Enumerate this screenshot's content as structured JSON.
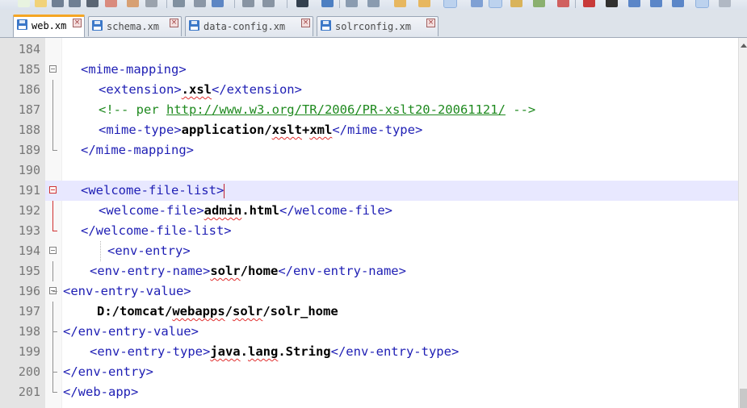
{
  "toolbar": {
    "buttons": [
      "new-file-icon",
      "open-file-icon",
      "save-icon",
      "save-all-icon",
      "close-icon",
      "close-all-icon",
      "print-icon",
      "cut-icon",
      "copy-icon",
      "paste-icon",
      "undo-icon",
      "redo-icon",
      "find-icon",
      "replace-icon",
      "zoom-in-icon",
      "zoom-out-icon",
      "sync-scroll-icon",
      "word-wrap-icon",
      "show-all-chars-icon",
      "indent-guide-icon",
      "user-lang-icon",
      "doc-map-icon",
      "record-macro-icon",
      "stop-record-icon",
      "play-macro-icon",
      "run-macro-icon",
      "save-macro-icon",
      "spellcheck-icon"
    ]
  },
  "tabs": [
    {
      "label": "web.xm",
      "active": true
    },
    {
      "label": "schema.xm",
      "active": false
    },
    {
      "label": "data-config.xm",
      "active": false
    },
    {
      "label": "solrconfig.xm",
      "active": false
    }
  ],
  "editor": {
    "current_line": 191,
    "lines": [
      {
        "num": "184"
      },
      {
        "num": "185",
        "t1": "<mime-mapping>"
      },
      {
        "num": "186",
        "t1": "<extension>",
        "v": ".xsl",
        "t2": "</extension>"
      },
      {
        "num": "187",
        "c1": "<!-- per ",
        "url": "http://www.w3.org/TR/2006/PR-xslt20-20061121/",
        "c2": " -->"
      },
      {
        "num": "188",
        "t1": "<mime-type>",
        "v": "application/xslt+xml",
        "t2": "</mime-type>"
      },
      {
        "num": "189",
        "t1": "</mime-mapping>"
      },
      {
        "num": "190"
      },
      {
        "num": "191",
        "t1": "<welcome-file-list>"
      },
      {
        "num": "192",
        "t1": "<welcome-file>",
        "v": "admin.html",
        "t2": "</welcome-file>"
      },
      {
        "num": "193",
        "t1": "</welcome-file-list>"
      },
      {
        "num": "194",
        "t1": "<env-entry>"
      },
      {
        "num": "195",
        "t1": "<env-entry-name>",
        "v": "solr/home",
        "t2": "</env-entry-name>"
      },
      {
        "num": "196",
        "t1": "<env-entry-value>"
      },
      {
        "num": "197",
        "v": "D:/tomcat/webapps/solr/solr_home"
      },
      {
        "num": "198",
        "t1": "</env-entry-value>"
      },
      {
        "num": "199",
        "t1": "<env-entry-type>",
        "v": "java.lang.String",
        "t2": "</env-entry-type>"
      },
      {
        "num": "200",
        "t1": "</env-entry>"
      },
      {
        "num": "201",
        "t1": "</web-app>"
      }
    ]
  },
  "colors": {
    "tag": "#1e1eb4",
    "text": "#000000",
    "comment": "#1f8a1f",
    "current_line": "#e8e8ff",
    "active_tab_accent": "#f5a623",
    "fold_marker_active": "#d03030"
  }
}
